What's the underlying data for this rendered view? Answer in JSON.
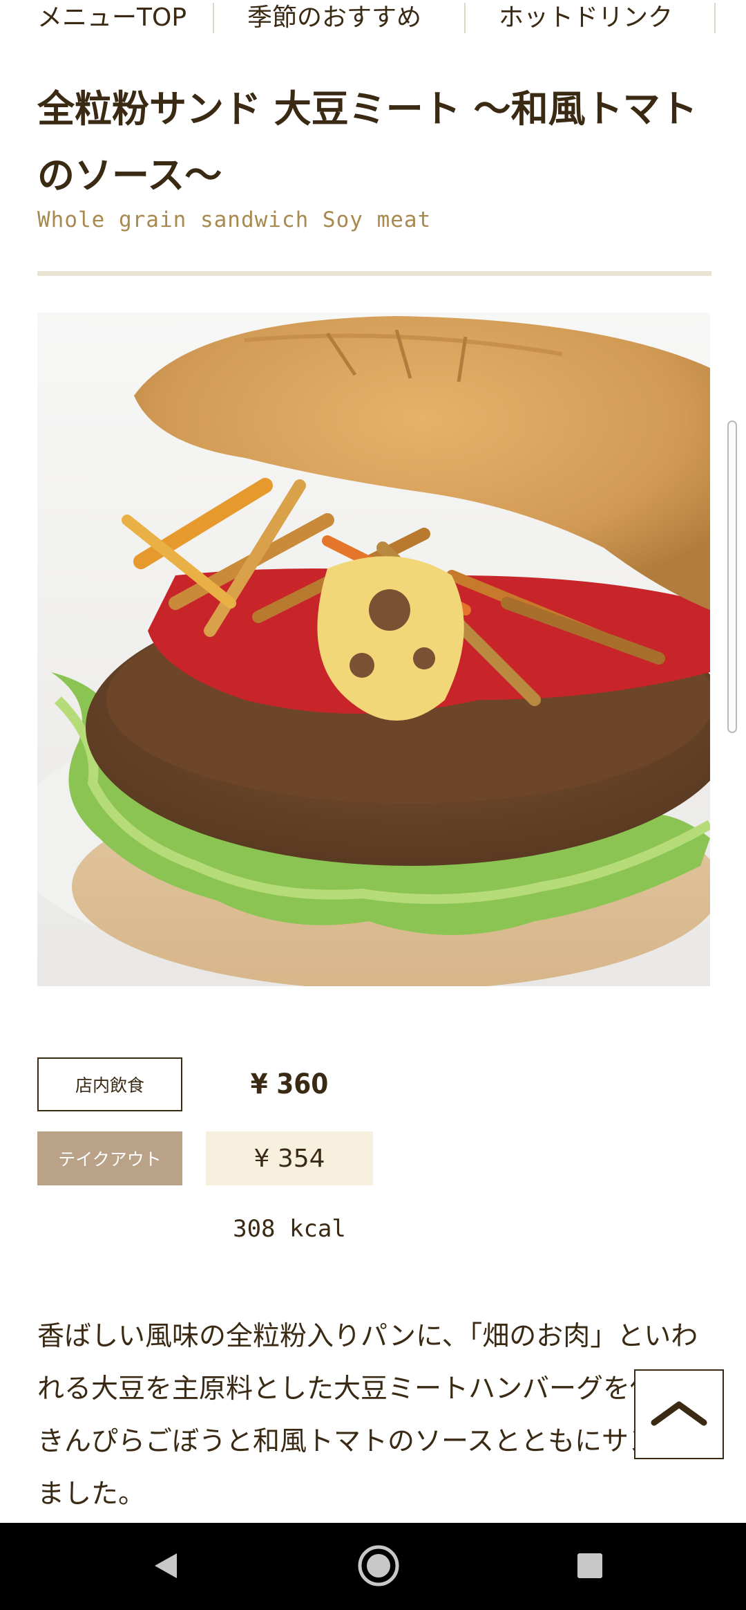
{
  "topnav": {
    "items": [
      "メニューTOP",
      "季節のおすすめ",
      "ホットドリンク"
    ]
  },
  "product": {
    "title": "全粒粉サンド 大豆ミート 〜和風トマトのソース〜",
    "subtitle": "Whole grain sandwich Soy meat",
    "dine_in_label": "店内飲食",
    "dine_in_price": "¥ 360",
    "takeout_label": "テイクアウト",
    "takeout_price": "¥ 354",
    "kcal": "308 kcal",
    "description": "香ばしい風味の全粒粉入りパンに、「畑のお肉」といわれる大豆を主原料とした大豆ミートハンバーグを使い、きんぴらごぼうと和風トマトのソースとともにサンドしました。"
  },
  "icons": {
    "back_to_top": "chevron-up-icon",
    "nav_back": "triangle-back-icon",
    "nav_home": "circle-home-icon",
    "nav_recents": "square-recents-icon"
  },
  "colors": {
    "text": "#3a2a14",
    "subtitle": "#a8894f",
    "takeout_bg": "#b9a288",
    "takeout_price_bg": "#f7f0df"
  }
}
